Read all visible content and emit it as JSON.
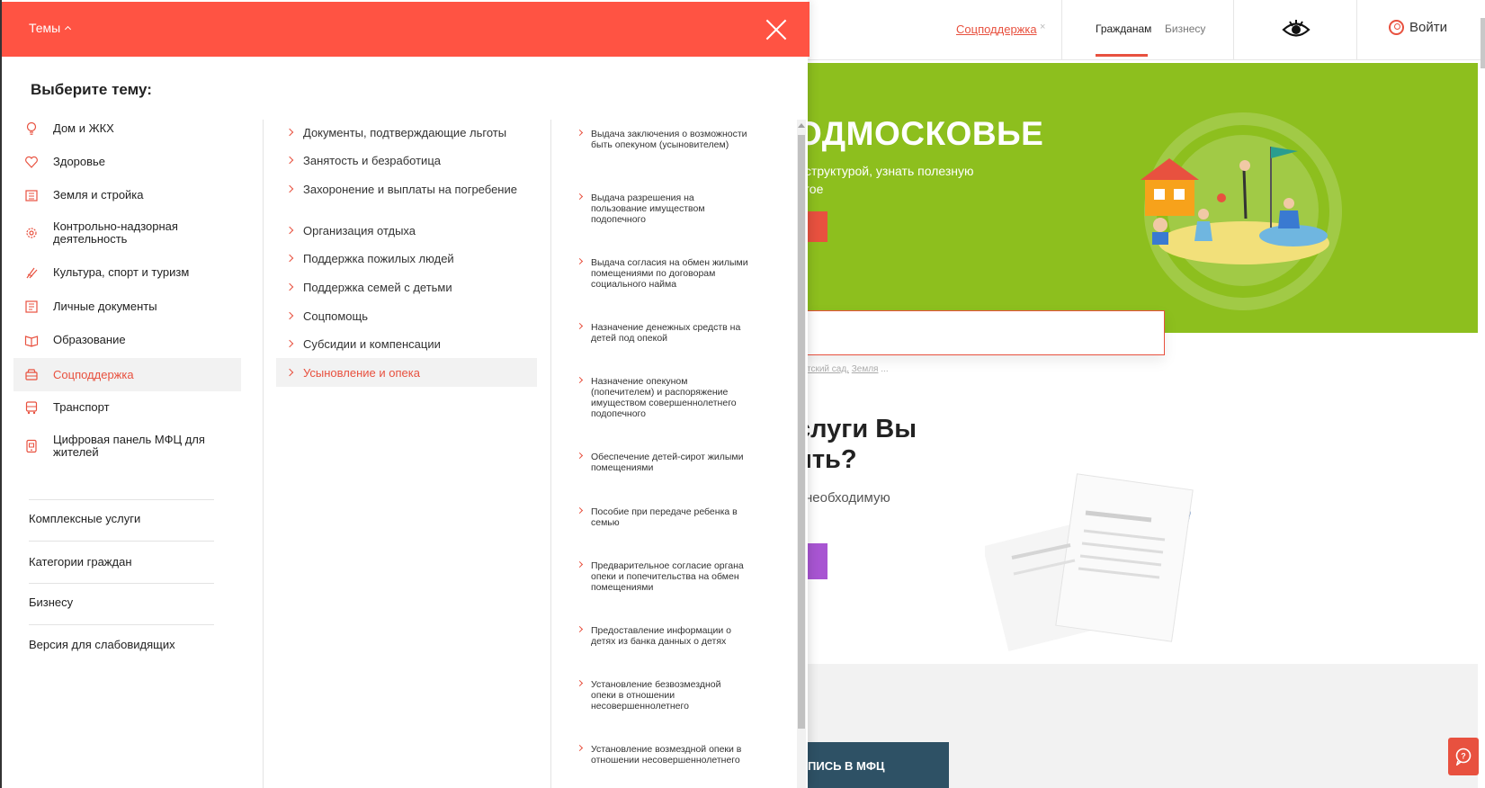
{
  "header": {
    "current_topic": "Соцподдержка",
    "tabs": [
      {
        "label": "Гражданам",
        "active": true
      },
      {
        "label": "Бизнесу",
        "active": false
      }
    ],
    "login_label": "Войти",
    "accent_color": "#e8513f"
  },
  "hero": {
    "title_fragment": "ОДМОСКОВЬЕ",
    "subtitle_line1": "структурой, узнать полезную",
    "subtitle_line2": "гое",
    "hint_prefix": "тский сад,",
    "hint_link": "Земля",
    "hint_suffix": " ...",
    "color": "#8dbf1e"
  },
  "services_promo": {
    "title_line1": "слуги Вы",
    "title_line2": "ить?",
    "subtitle": "необходимую",
    "mfc_button": "ПИСЬ В МФЦ"
  },
  "menu": {
    "toggle_label": "Темы",
    "choose_title": "Выберите тему:",
    "topics": [
      {
        "label": "Дом и ЖКХ",
        "icon": "lightbulb-icon",
        "active": false
      },
      {
        "label": "Здоровье",
        "icon": "heart-icon",
        "active": false
      },
      {
        "label": "Земля и стройка",
        "icon": "building-icon",
        "active": false
      },
      {
        "label": "Контрольно-надзорная деятельность",
        "icon": "gear-icon",
        "active": false
      },
      {
        "label": "Культура, спорт и туризм",
        "icon": "flag-icon",
        "active": false
      },
      {
        "label": "Личные документы",
        "icon": "document-icon",
        "active": false
      },
      {
        "label": "Образование",
        "icon": "book-icon",
        "active": false
      },
      {
        "label": "Соцподдержка",
        "icon": "support-icon",
        "active": true
      },
      {
        "label": "Транспорт",
        "icon": "bus-icon",
        "active": false
      },
      {
        "label": "Цифровая панель МФЦ для жителей",
        "icon": "tablet-icon",
        "active": false
      }
    ],
    "extra_links": [
      "Комплексные услуги",
      "Категории граждан",
      "Бизнесу",
      "Версия для слабовидящих"
    ],
    "subtopics": [
      {
        "label": "Документы, подтверждающие льготы",
        "active": false
      },
      {
        "label": "Занятость и безработица",
        "active": false
      },
      {
        "label": "Захоронение и выплаты на погребение",
        "active": false
      },
      {
        "label": "Организация отдыха",
        "active": false
      },
      {
        "label": "Поддержка пожилых людей",
        "active": false
      },
      {
        "label": "Поддержка семей с детьми",
        "active": false
      },
      {
        "label": "Соцпомощь",
        "active": false
      },
      {
        "label": "Субсидии и компенсации",
        "active": false
      },
      {
        "label": "Усыновление и опека",
        "active": true
      }
    ],
    "services": [
      "Выдача заключения о возможности быть опекуном (усыновителем)",
      "Выдача разрешения на пользование имуществом подопечного",
      "Выдача согласия на обмен жилыми помещениями по договорам социального найма",
      "Назначение денежных средств на детей под опекой",
      "Назначение опекуном (попечителем) и распоряжение имуществом совершеннолетнего подопечного",
      "Обеспечение детей-сирот жилыми помещениями",
      "Пособие при передаче ребенка в семью",
      "Предварительное согласие органа опеки и попечительства на обмен помещениями",
      "Предоставление информации о детях из банка данных о детях",
      "Установление безвозмездной опеки в отношении несовершеннолетнего",
      "Установление возмездной опеки в отношении несовершеннолетнего"
    ],
    "topbar_color": "#ff5343"
  }
}
